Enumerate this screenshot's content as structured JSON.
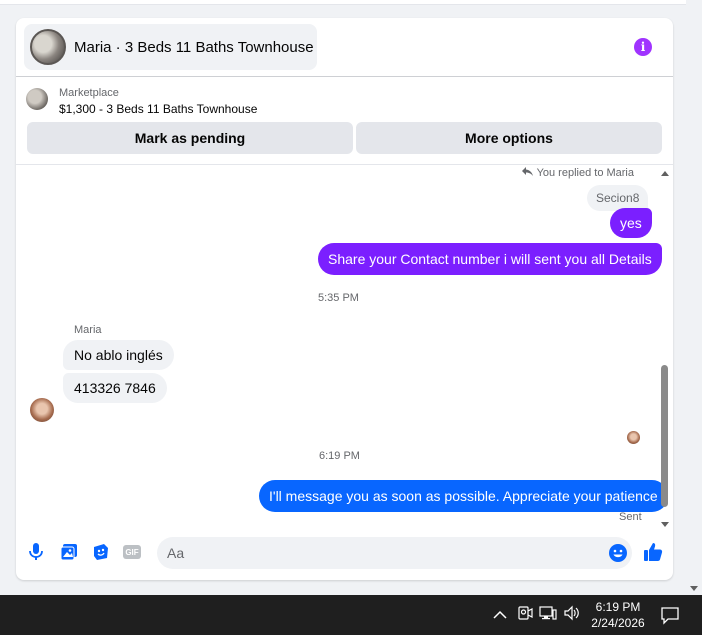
{
  "header": {
    "title": "Maria · 3 Beds 11 Baths Townhouse"
  },
  "listing": {
    "category": "Marketplace",
    "title": "$1,300 - 3 Beds 11 Baths Townhouse"
  },
  "actions": {
    "pending_label": "Mark as pending",
    "more_label": "More options"
  },
  "messages": {
    "replied_note": "You replied to Maria",
    "quoted_text": "Secion8",
    "outgoing_1": "yes",
    "outgoing_2": "Share your Contact number i will sent you all Details",
    "time_1": "5:35 PM",
    "sender_name": "Maria",
    "incoming_1": "No ablo inglés",
    "incoming_2": "413326 7846",
    "time_2": "6:19 PM",
    "outgoing_3": "I'll message you as soon as possible. Appreciate your patience",
    "status": "Sent"
  },
  "composer": {
    "placeholder": "Aa"
  },
  "taskbar": {
    "time": "6:19 PM",
    "date": "2/24/2026"
  },
  "colors": {
    "outgoing_purple": "#7b1fff",
    "outgoing_blue": "#0866ff",
    "accent_blue": "#0866ff",
    "info_purple": "#a033ff"
  }
}
